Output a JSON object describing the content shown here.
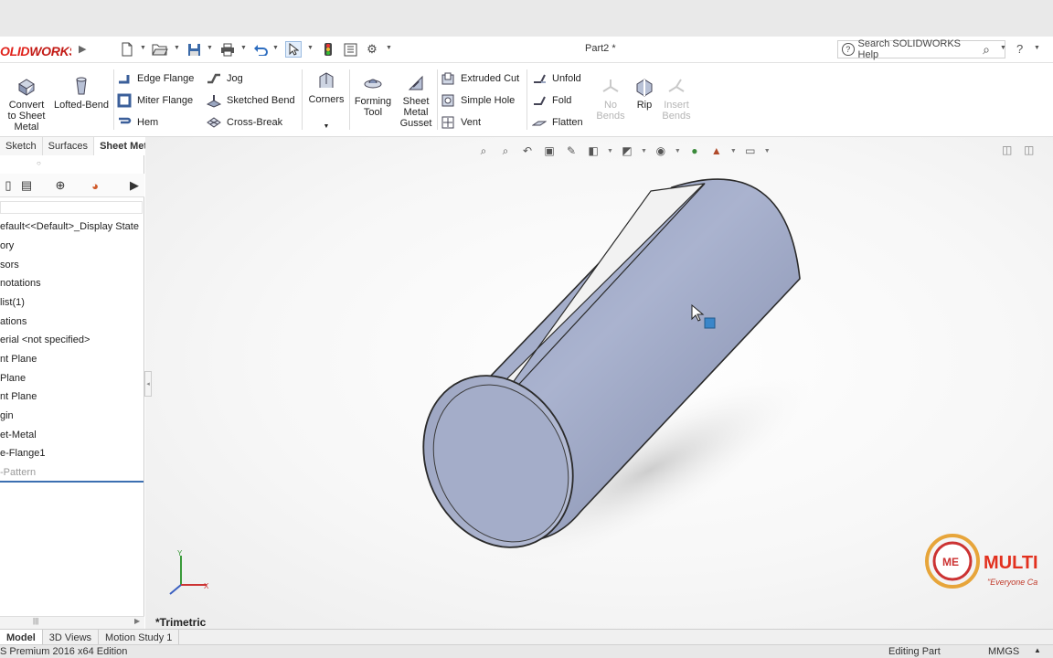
{
  "app": {
    "logo_text_a": "OLID",
    "logo_text_b": "WORKS",
    "doc_title": "Part2 *",
    "search_placeholder": "Search SOLIDWORKS Help",
    "help_label": "?"
  },
  "ribbon": {
    "convert": [
      "Convert",
      "to Sheet",
      "Metal"
    ],
    "lofted_bend": "Lofted-Bend",
    "edge_flange": "Edge Flange",
    "miter_flange": "Miter Flange",
    "hem": "Hem",
    "jog": "Jog",
    "sketched_bend": "Sketched Bend",
    "cross_break": "Cross-Break",
    "corners": "Corners",
    "forming_tool": [
      "Forming",
      "Tool"
    ],
    "sheet_metal_gusset": [
      "Sheet",
      "Metal",
      "Gusset"
    ],
    "extruded_cut": "Extruded Cut",
    "simple_hole": "Simple Hole",
    "vent": "Vent",
    "unfold": "Unfold",
    "fold": "Fold",
    "flatten": "Flatten",
    "no_bends": [
      "No",
      "Bends"
    ],
    "rip": "Rip",
    "insert_bends": [
      "Insert",
      "Bends"
    ]
  },
  "command_tabs": [
    "Sketch",
    "Surfaces",
    "Sheet Metal"
  ],
  "tree": [
    "efault<<Default>_Display State",
    "ory",
    "sors",
    "notations",
    " list(1)",
    "ations",
    "erial <not specified>",
    "nt Plane",
    " Plane",
    "nt Plane",
    "gin",
    "et-Metal",
    "e-Flange1",
    "-Pattern"
  ],
  "viewport": {
    "view_name": "*Trimetric"
  },
  "bottom_tabs": [
    "Model",
    "3D Views",
    "Motion Study 1"
  ],
  "status": {
    "edition": "S Premium 2016 x64 Edition",
    "mode": "Editing Part",
    "units": "MMGS"
  },
  "watermark": {
    "initials": "ME",
    "brand": "MULTI",
    "tagline": "\"Everyone Ca"
  }
}
